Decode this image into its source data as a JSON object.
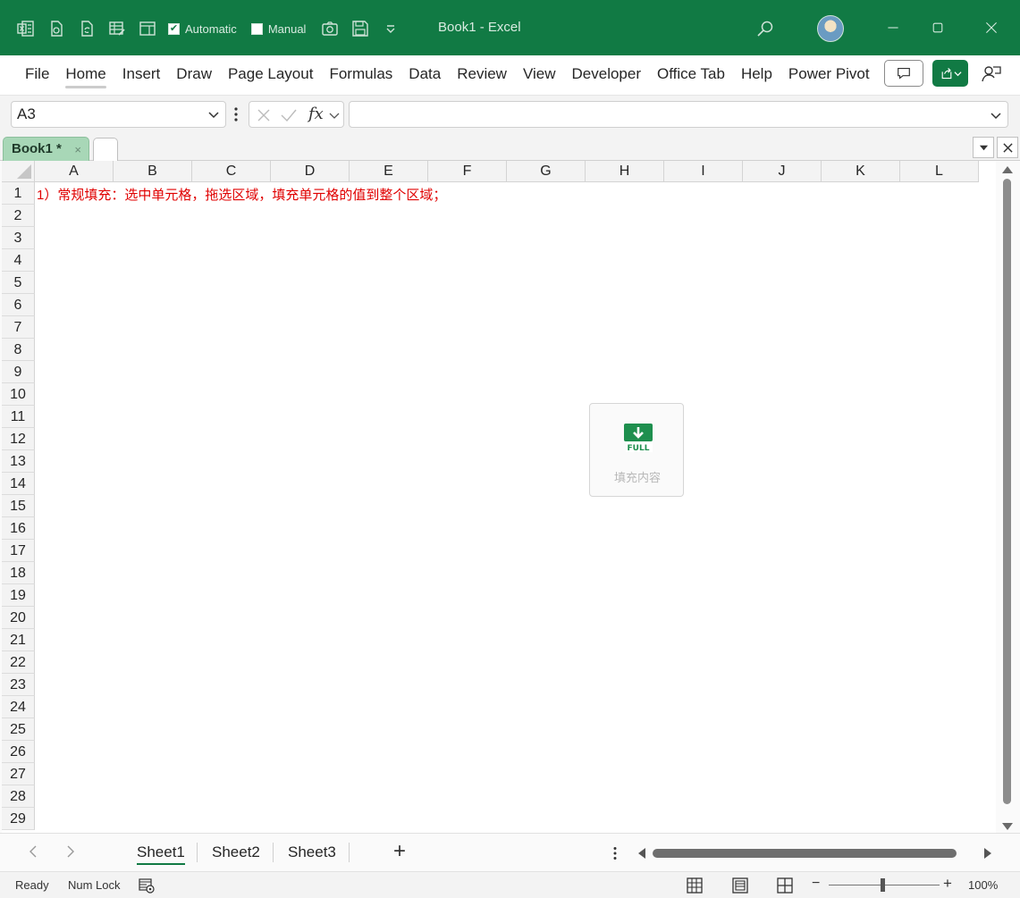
{
  "titlebar": {
    "autosave_auto_label": "Automatic",
    "autosave_manual_label": "Manual",
    "document_title": "Book1  -  Excel"
  },
  "ribbon": {
    "tabs": [
      {
        "label": "File"
      },
      {
        "label": "Home"
      },
      {
        "label": "Insert"
      },
      {
        "label": "Draw"
      },
      {
        "label": "Page Layout"
      },
      {
        "label": "Formulas"
      },
      {
        "label": "Data"
      },
      {
        "label": "Review"
      },
      {
        "label": "View"
      },
      {
        "label": "Developer"
      },
      {
        "label": "Office Tab"
      },
      {
        "label": "Help"
      },
      {
        "label": "Power Pivot"
      }
    ]
  },
  "formula_bar": {
    "name_box": "A3",
    "fx_label": "fx",
    "formula": ""
  },
  "office_tab": {
    "book_tab": "Book1 *",
    "close_glyph": "×"
  },
  "grid": {
    "columns": [
      "A",
      "B",
      "C",
      "D",
      "E",
      "F",
      "G",
      "H",
      "I",
      "J",
      "K",
      "L"
    ],
    "rows": [
      "1",
      "2",
      "3",
      "4",
      "5",
      "6",
      "7",
      "8",
      "9",
      "10",
      "11",
      "12",
      "13",
      "14",
      "15",
      "16",
      "17",
      "18",
      "19",
      "20",
      "21",
      "22",
      "23",
      "24",
      "25",
      "26",
      "27",
      "28",
      "29"
    ],
    "a1_text": "1）常规填充：选中单元格，拖选区域，填充单元格的值到整个区域；"
  },
  "widget": {
    "logo_text": "FULL",
    "label": "填充内容"
  },
  "sheets": [
    {
      "label": "Sheet1"
    },
    {
      "label": "Sheet2"
    },
    {
      "label": "Sheet3"
    }
  ],
  "add_sheet": "+",
  "status": {
    "ready": "Ready",
    "num_lock": "Num Lock",
    "zoom_minus": "−",
    "zoom_plus": "+",
    "zoom": "100%"
  },
  "colors": {
    "brand_green": "#117a44",
    "a1_text_red": "#e00000",
    "book_tab_green": "#a8d7b7"
  }
}
